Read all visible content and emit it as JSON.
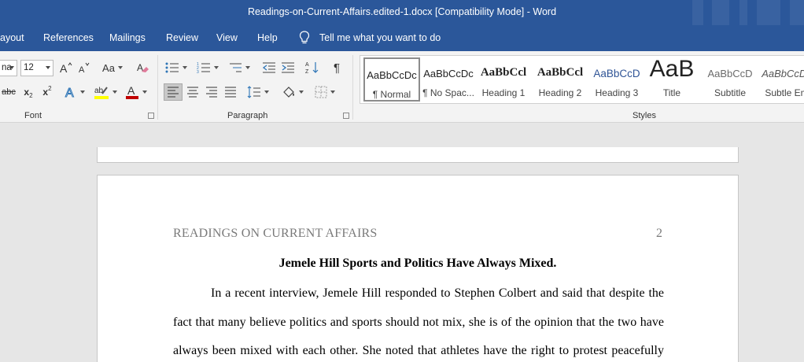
{
  "window": {
    "title": "Readings-on-Current-Affairs.edited-1.docx [Compatibility Mode]  -  Word"
  },
  "menu": {
    "tabs": [
      "ayout",
      "References",
      "Mailings",
      "Review",
      "View",
      "Help"
    ],
    "tell_me": "Tell me what you want to do"
  },
  "font_group": {
    "label": "Font",
    "font_name": "na",
    "font_size": "12",
    "change_case": "Aa",
    "strikethrough": "abc",
    "subscript": "x",
    "subscript_mark": "2",
    "superscript": "x",
    "superscript_mark": "2",
    "font_color": "#c00000",
    "highlight_color": "#ffff00"
  },
  "paragraph_group": {
    "label": "Paragraph",
    "pilcrow": "¶"
  },
  "styles_group": {
    "label": "Styles",
    "items": [
      {
        "sample": "AaBbCcDc",
        "name": "¶ Normal"
      },
      {
        "sample": "AaBbCcDc",
        "name": "¶ No Spac..."
      },
      {
        "sample": "AaBbCcl",
        "name": "Heading 1"
      },
      {
        "sample": "AaBbCcl",
        "name": "Heading 2"
      },
      {
        "sample": "AaBbCcD",
        "name": "Heading 3"
      },
      {
        "sample": "AaB",
        "name": "Title"
      },
      {
        "sample": "AaBbCcD",
        "name": "Subtitle"
      },
      {
        "sample": "AaBbCcDc",
        "name": "Subtle Em"
      }
    ]
  },
  "document": {
    "running_head": "READINGS ON CURRENT AFFAIRS",
    "page_number": "2",
    "title": "Jemele Hill Sports and Politics Have Always Mixed.",
    "lines": [
      "In a recent interview, Jemele Hill responded to Stephen Colbert and said that despite the",
      "fact that many believe politics and sports should not mix, she is of the opinion that the two have",
      "always been mixed with each other. She noted that athletes have the right to protest peacefully"
    ]
  },
  "colors": {
    "titlebar": "#2b579a",
    "ribbon": "#f3f3f3",
    "canvas": "#e6e6e6",
    "heading_blue": "#2f5496"
  }
}
